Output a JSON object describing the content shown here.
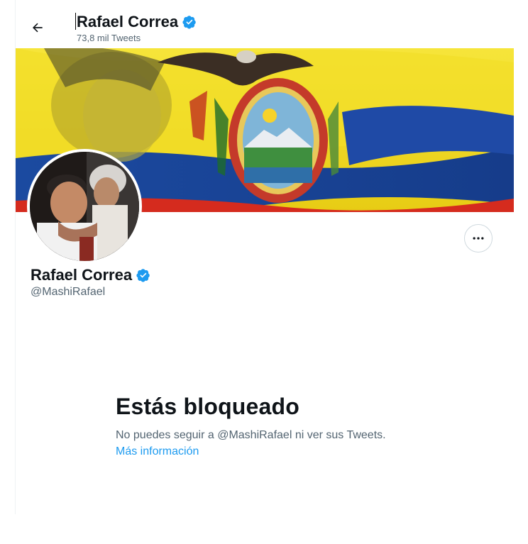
{
  "header": {
    "name": "Rafael Correa",
    "tweet_count": "73,8 mil Tweets"
  },
  "profile": {
    "name": "Rafael Correa",
    "handle": "@MashiRafael"
  },
  "blocked": {
    "title": "Estás bloqueado",
    "description": "No puedes seguir a @MashiRafael ni ver sus Tweets.",
    "more_info": "Más información"
  },
  "colors": {
    "accent": "#1d9bf0",
    "verified": "#1d9bf0",
    "flag_yellow": "#f3dd2a",
    "flag_blue": "#1a3d8f",
    "flag_red": "#d52b1e"
  },
  "icons": {
    "back": "arrow-left-icon",
    "verified": "verified-badge-icon",
    "more": "more-horizontal-icon"
  }
}
